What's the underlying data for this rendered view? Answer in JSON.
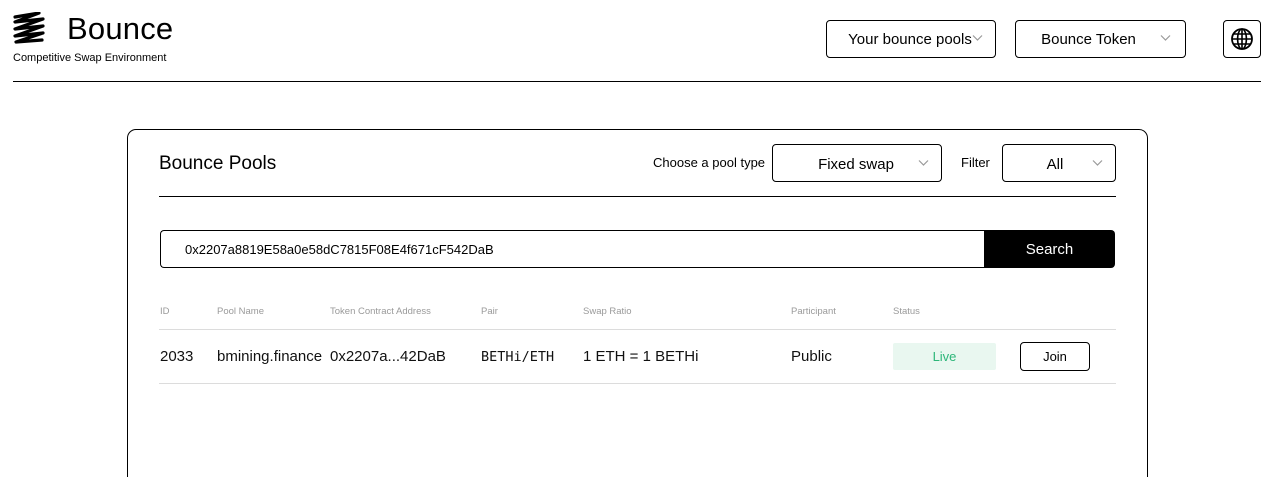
{
  "header": {
    "brand_name": "Bounce",
    "brand_tagline": "Competitive Swap Environment",
    "logo_icon": "bounce-zigzag-logo",
    "pools_select_label": "Your bounce pools",
    "token_select_label": "Bounce Token",
    "language_icon": "globe-icon"
  },
  "card": {
    "title": "Bounce Pools",
    "pool_type_label": "Choose a pool type",
    "pool_type_value": "Fixed swap",
    "filter_label": "Filter",
    "filter_value": "All",
    "search_value": "0x2207a8819E58a0e58dC7815F08E4f671cF542DaB",
    "search_button": "Search"
  },
  "table": {
    "columns": [
      "ID",
      "Pool Name",
      "Token Contract Address",
      "Pair",
      "Swap Ratio",
      "Participant",
      "Status"
    ],
    "rows": [
      {
        "id": "2033",
        "pool_name": "bmining.finance",
        "address": "0x2207a...42DaB",
        "pair": "BETHi/ETH",
        "ratio": "1 ETH = 1 BETHi",
        "participant": "Public",
        "status": "Live",
        "action": "Join"
      }
    ]
  },
  "colors": {
    "status_live_text": "#2db679",
    "status_live_bg": "#e9f7f0",
    "primary": "#000000"
  }
}
